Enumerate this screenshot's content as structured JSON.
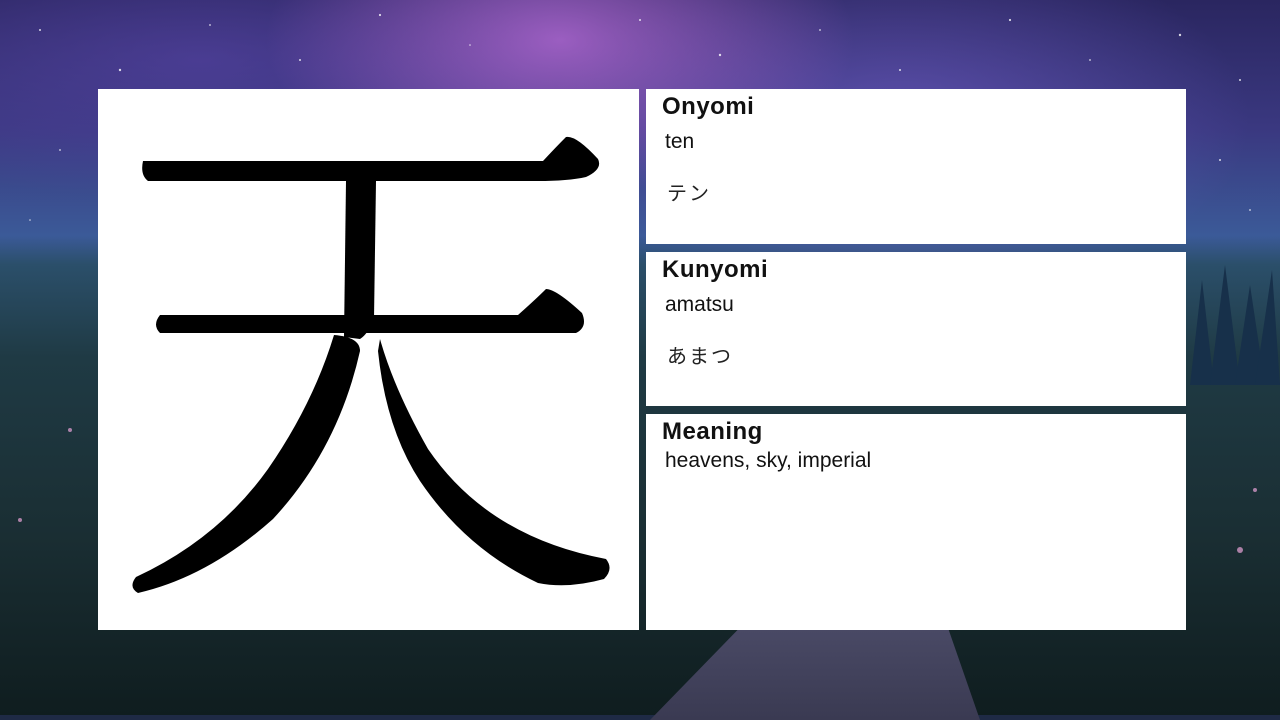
{
  "kanji": {
    "character": "天"
  },
  "onyomi": {
    "heading": "Onyomi",
    "romaji": "ten",
    "kana": "テン"
  },
  "kunyomi": {
    "heading": "Kunyomi",
    "romaji": "amatsu",
    "kana": "あまつ"
  },
  "meaning": {
    "heading": "Meaning",
    "text": "heavens, sky, imperial"
  },
  "colors": {
    "card_background": "#ffffff",
    "text": "#111111",
    "sky_purple": "#3a3880",
    "grass_dark": "#1a2e33"
  },
  "icons": {
    "background": "night-sky-landscape-icon"
  }
}
